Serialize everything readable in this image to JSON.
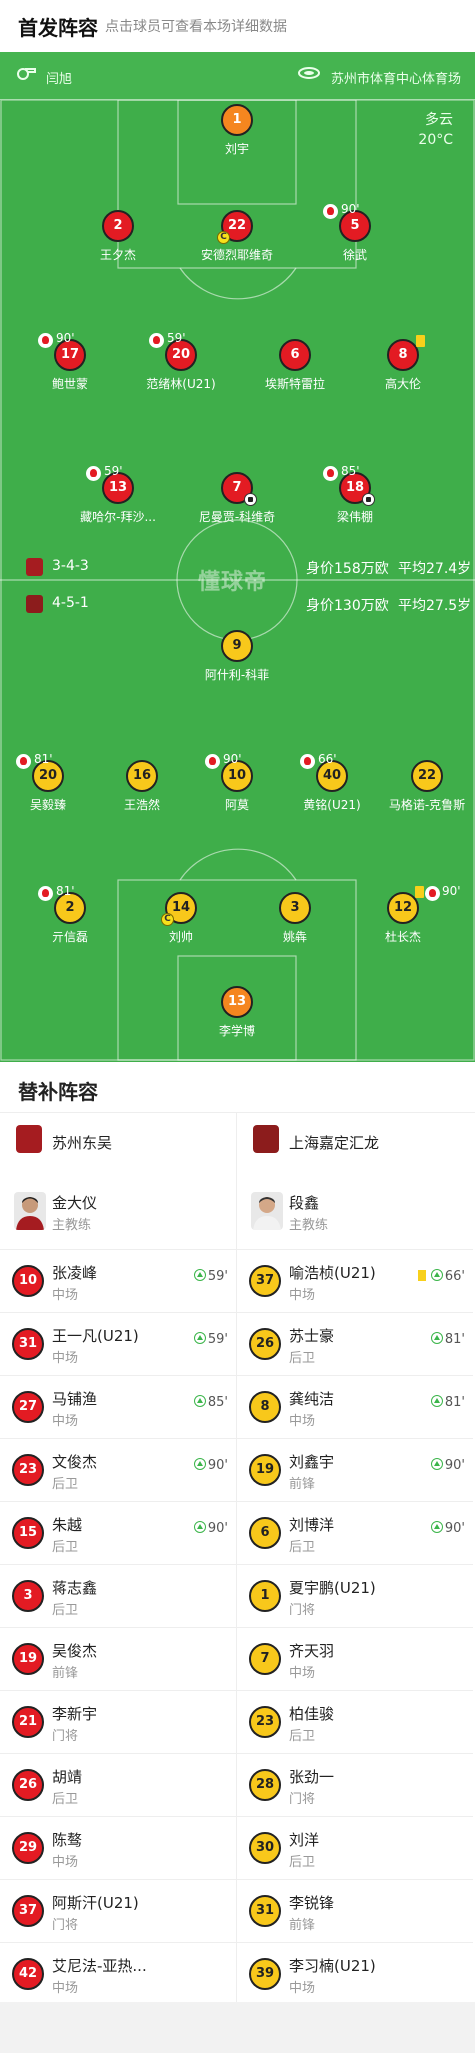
{
  "header": {
    "title": "首发阵容",
    "subtitle": "点击球员可查看本场详细数据"
  },
  "match": {
    "referee": "闫旭",
    "venue": "苏州市体育中心体育场",
    "weather": "多云",
    "temperature": "20°C",
    "watermark": "懂球帝"
  },
  "home_team": {
    "formation": "3-4-3",
    "value": "身价158万欧",
    "age": "平均27.4岁",
    "logo_color": "#a51c20"
  },
  "away_team": {
    "formation": "4-5-1",
    "value": "身价130万欧",
    "age": "平均27.5岁",
    "logo_color": "#8c1c1c"
  },
  "home_lineup": [
    {
      "num": "1",
      "name": "刘宇",
      "color": "orange"
    },
    {
      "num": "2",
      "name": "王夕杰",
      "color": "red"
    },
    {
      "num": "22",
      "name": "安德烈耶维奇",
      "color": "red",
      "captain": "C"
    },
    {
      "num": "5",
      "name": "徐武",
      "color": "red",
      "sub_out": "90'"
    },
    {
      "num": "17",
      "name": "鲍世蒙",
      "color": "red",
      "sub_out": "90'"
    },
    {
      "num": "20",
      "name": "范绪林(U21)",
      "color": "red",
      "sub_out": "59'"
    },
    {
      "num": "6",
      "name": "埃斯特雷拉",
      "color": "red"
    },
    {
      "num": "8",
      "name": "高大伦",
      "color": "red"
    },
    {
      "num": "13",
      "name": "藏哈尔-拜沙...",
      "color": "red",
      "sub_out": "59'"
    },
    {
      "num": "7",
      "name": "尼曼贾-科维奇",
      "color": "red"
    },
    {
      "num": "18",
      "name": "梁伟棚",
      "color": "red",
      "sub_out": "85'"
    }
  ],
  "away_lineup": [
    {
      "num": "9",
      "name": "阿什利-科菲",
      "color": "yellow"
    },
    {
      "num": "20",
      "name": "吴毅臻",
      "color": "yellow",
      "sub_out": "81'"
    },
    {
      "num": "16",
      "name": "王浩然",
      "color": "yellow"
    },
    {
      "num": "10",
      "name": "阿莫",
      "color": "yellow",
      "sub_out": "90'"
    },
    {
      "num": "40",
      "name": "黄铭(U21)",
      "color": "yellow",
      "sub_out": "66'"
    },
    {
      "num": "22",
      "name": "马格诺-克鲁斯",
      "color": "yellow"
    },
    {
      "num": "2",
      "name": "亓信磊",
      "color": "yellow",
      "sub_out": "81'"
    },
    {
      "num": "14",
      "name": "刘帅",
      "color": "yellow",
      "captain": "C"
    },
    {
      "num": "3",
      "name": "姚犇",
      "color": "yellow"
    },
    {
      "num": "12",
      "name": "杜长杰",
      "color": "yellow",
      "sub_out": "90'"
    },
    {
      "num": "13",
      "name": "李学博",
      "color": "orange"
    }
  ],
  "subs": {
    "title": "替补阵容",
    "home": {
      "team_name": "苏州东吴",
      "coach": {
        "name": "金大仪",
        "role": "主教练"
      },
      "players": [
        {
          "num": "10",
          "name": "张凌峰",
          "pos": "中场",
          "sub_in": "59'"
        },
        {
          "num": "31",
          "name": "王一凡(U21)",
          "pos": "中场",
          "sub_in": "59'"
        },
        {
          "num": "27",
          "name": "马铺渔",
          "pos": "中场",
          "sub_in": "85'"
        },
        {
          "num": "23",
          "name": "文俊杰",
          "pos": "后卫",
          "sub_in": "90'"
        },
        {
          "num": "15",
          "name": "朱越",
          "pos": "后卫",
          "sub_in": "90'"
        },
        {
          "num": "3",
          "name": "蒋志鑫",
          "pos": "后卫",
          "sub_in": ""
        },
        {
          "num": "19",
          "name": "吴俊杰",
          "pos": "前锋",
          "sub_in": ""
        },
        {
          "num": "21",
          "name": "李新宇",
          "pos": "门将",
          "sub_in": ""
        },
        {
          "num": "26",
          "name": "胡靖",
          "pos": "后卫",
          "sub_in": ""
        },
        {
          "num": "29",
          "name": "陈骜",
          "pos": "中场",
          "sub_in": ""
        },
        {
          "num": "37",
          "name": "阿斯汗(U21)",
          "pos": "门将",
          "sub_in": ""
        },
        {
          "num": "42",
          "name": "艾尼法-亚热...",
          "pos": "中场",
          "sub_in": ""
        }
      ]
    },
    "away": {
      "team_name": "上海嘉定汇龙",
      "coach": {
        "name": "段鑫",
        "role": "主教练"
      },
      "players": [
        {
          "num": "37",
          "name": "喻浩桢(U21)",
          "pos": "中场",
          "sub_in": "66'",
          "yellow": true
        },
        {
          "num": "26",
          "name": "苏士豪",
          "pos": "后卫",
          "sub_in": "81'"
        },
        {
          "num": "8",
          "name": "龚纯洁",
          "pos": "中场",
          "sub_in": "81'"
        },
        {
          "num": "19",
          "name": "刘鑫宇",
          "pos": "前锋",
          "sub_in": "90'"
        },
        {
          "num": "6",
          "name": "刘博洋",
          "pos": "后卫",
          "sub_in": "90'"
        },
        {
          "num": "1",
          "name": "夏宇鹏(U21)",
          "pos": "门将",
          "sub_in": ""
        },
        {
          "num": "7",
          "name": "齐天羽",
          "pos": "中场",
          "sub_in": ""
        },
        {
          "num": "23",
          "name": "柏佳骏",
          "pos": "后卫",
          "sub_in": ""
        },
        {
          "num": "28",
          "name": "张劲一",
          "pos": "门将",
          "sub_in": ""
        },
        {
          "num": "30",
          "name": "刘洋",
          "pos": "后卫",
          "sub_in": ""
        },
        {
          "num": "31",
          "name": "李锐锋",
          "pos": "前锋",
          "sub_in": ""
        },
        {
          "num": "39",
          "name": "李习楠(U21)",
          "pos": "中场",
          "sub_in": ""
        }
      ]
    }
  }
}
